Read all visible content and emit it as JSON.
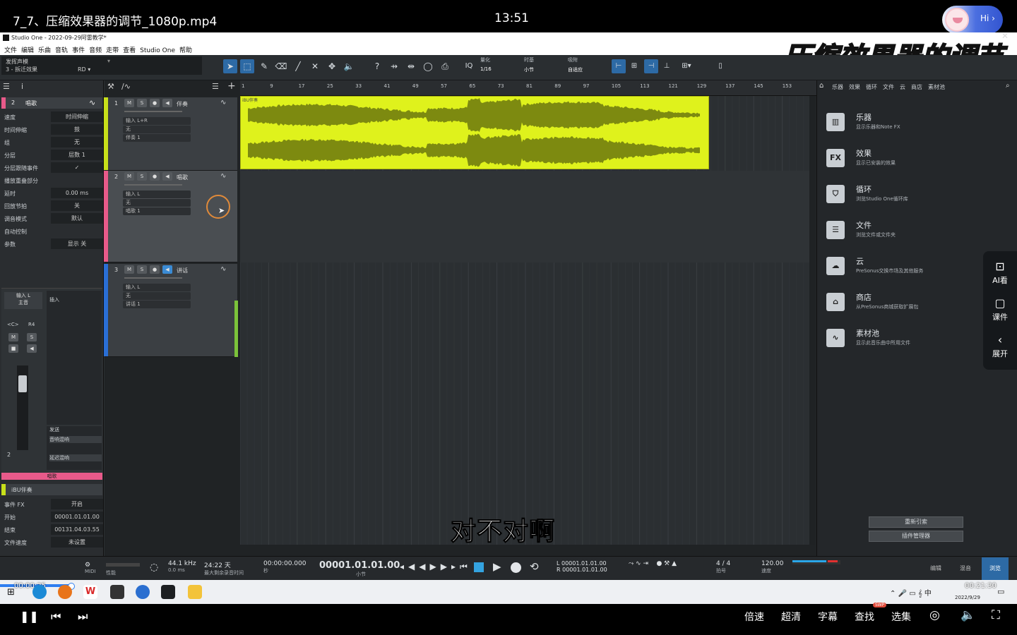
{
  "video": {
    "title": "7_7、压缩效果器的调节_1080p.mp4",
    "clock": "13:51",
    "avatar_label": "Hi ›",
    "overlay_title": "压缩效果器的调节",
    "subtitle": "对不对啊",
    "progress": 0.072,
    "time_current": "00:00:25",
    "time_total": "00:21:30"
  },
  "app": {
    "window_title": "Studio One - 2022-09-29阿雷教学*",
    "menu": [
      "文件",
      "编辑",
      "乐曲",
      "音轨",
      "事件",
      "音频",
      "走带",
      "查看",
      "Studio One",
      "帮助"
    ],
    "song_name": "发挥声模",
    "song_sub": "3 - 拆迁效果",
    "song_info": "RD ▾",
    "toolbar_fields": [
      {
        "label": "量化",
        "value": "1/16"
      },
      {
        "label": "时基",
        "value": "小节"
      },
      {
        "label": "吸附",
        "value": "自适应"
      }
    ]
  },
  "inspector": {
    "track_num": "2",
    "track_name": "唱歌",
    "rows": [
      {
        "k": "速度",
        "v": "时间伸缩"
      },
      {
        "k": "时间伸缩",
        "v": "鼓"
      },
      {
        "k": "组",
        "v": "无"
      },
      {
        "k": "分层",
        "v": "层数 1"
      },
      {
        "k": "分层跟随事件",
        "v": "✓"
      },
      {
        "k": "播放重叠部分",
        "v": ""
      },
      {
        "k": "延时",
        "v": "0.00 ms"
      },
      {
        "k": "回放节拍",
        "v": "关"
      },
      {
        "k": "调音模式",
        "v": "默认"
      },
      {
        "k": "自动控制",
        "v": ""
      },
      {
        "k": "参数",
        "v": "显示 关"
      }
    ],
    "channel": {
      "input": "输入 L",
      "bus": "主音",
      "pan": "<C>",
      "right": "R4",
      "m": "M",
      "s": "S",
      "insert_label": "插入",
      "send_label": "发送",
      "send1": "音响混响",
      "send2": "延迟混响",
      "fader_num": "2"
    },
    "channel_name": "唱歌",
    "event_name": "iBU伴奏",
    "event_rows": [
      {
        "k": "事件 FX",
        "v": "开启"
      },
      {
        "k": "开始",
        "v": "00001.01.01.00"
      },
      {
        "k": "结束",
        "v": "00131.04.03.55"
      },
      {
        "k": "文件速度",
        "v": "未设置"
      }
    ]
  },
  "tracks": [
    {
      "num": "1",
      "name": "伴奏",
      "input": "输入 L+R",
      "out": "无",
      "inst": "伴奏 1"
    },
    {
      "num": "2",
      "name": "唱歌",
      "input": "输入 L",
      "out": "无",
      "inst": "唱歌 1"
    },
    {
      "num": "3",
      "name": "讲话",
      "input": "输入 L",
      "out": "无",
      "inst": "讲话 1"
    }
  ],
  "track_buttons": [
    "M",
    "S",
    "●",
    "◀"
  ],
  "ruler_ticks": [
    "1",
    "9",
    "17",
    "25",
    "33",
    "41",
    "49",
    "57",
    "65",
    "73",
    "81",
    "89",
    "97",
    "105",
    "113",
    "121",
    "129",
    "137",
    "145",
    "153"
  ],
  "clip_name": "iBU伴奏",
  "browser": {
    "tabs": [
      "乐器",
      "效果",
      "循环",
      "文件",
      "云",
      "商店",
      "素材池"
    ],
    "items": [
      {
        "icon": "piano-icon",
        "glyph": "▥",
        "title": "乐器",
        "desc": "显示乐器和Note FX"
      },
      {
        "icon": "fx-icon",
        "glyph": "FX",
        "title": "效果",
        "desc": "显示已安装的效果"
      },
      {
        "icon": "loop-icon",
        "glyph": "⛉",
        "title": "循环",
        "desc": "浏览Studio One循环库"
      },
      {
        "icon": "file-icon",
        "glyph": "☰",
        "title": "文件",
        "desc": "浏览文件或文件夹"
      },
      {
        "icon": "cloud-icon",
        "glyph": "☁",
        "title": "云",
        "desc": "PreSonus交换市场及其他服务"
      },
      {
        "icon": "shop-icon",
        "glyph": "⌂",
        "title": "商店",
        "desc": "从PreSonus商城获取扩展包"
      },
      {
        "icon": "pool-icon",
        "glyph": "∿",
        "title": "素材池",
        "desc": "显示此音乐曲中所用文件"
      }
    ],
    "btn_reindex": "重新引索",
    "btn_manage": "插件管理器"
  },
  "ai_panel": [
    {
      "icon": "ai-view-icon",
      "glyph": "⊡",
      "label": "AI看"
    },
    {
      "icon": "courseware-icon",
      "glyph": "▢",
      "label": "课件"
    },
    {
      "icon": "expand-icon",
      "glyph": "‹",
      "label": "展开"
    }
  ],
  "transport": {
    "sample_rate": "44.1 kHz",
    "latency": "0.0 ms",
    "record_time": "24:22 天",
    "record_label": "最大剩余录音时间",
    "time_sec": "00:00:00.000",
    "time_sec_label": "秒",
    "bars": "00001.01.01.00",
    "bars_label": "小节",
    "loc_l": "L  00001.01.01.00",
    "loc_r": "R  00001.01.01.00",
    "signature": "4 / 4",
    "sig_label": "拍号",
    "tempo": "120.00",
    "tempo_label": "速度",
    "tabs": [
      "编辑",
      "混音",
      "浏览"
    ],
    "midi_label": "MIDI",
    "perf_label": "性能"
  },
  "taskbar": {
    "date": "2022/9/29",
    "sys": "⌃ 🎤 ▭ 𝄞 中"
  },
  "player": {
    "controls": [
      "倍速",
      "超清",
      "字幕",
      "查找",
      "选集"
    ],
    "badge": "SWP"
  },
  "colors": {
    "clip": "#dff21c",
    "accent": "#2d6aa5",
    "track1": "#c8e01a",
    "track2": "#e85a8a",
    "track3": "#2a6fd6"
  }
}
